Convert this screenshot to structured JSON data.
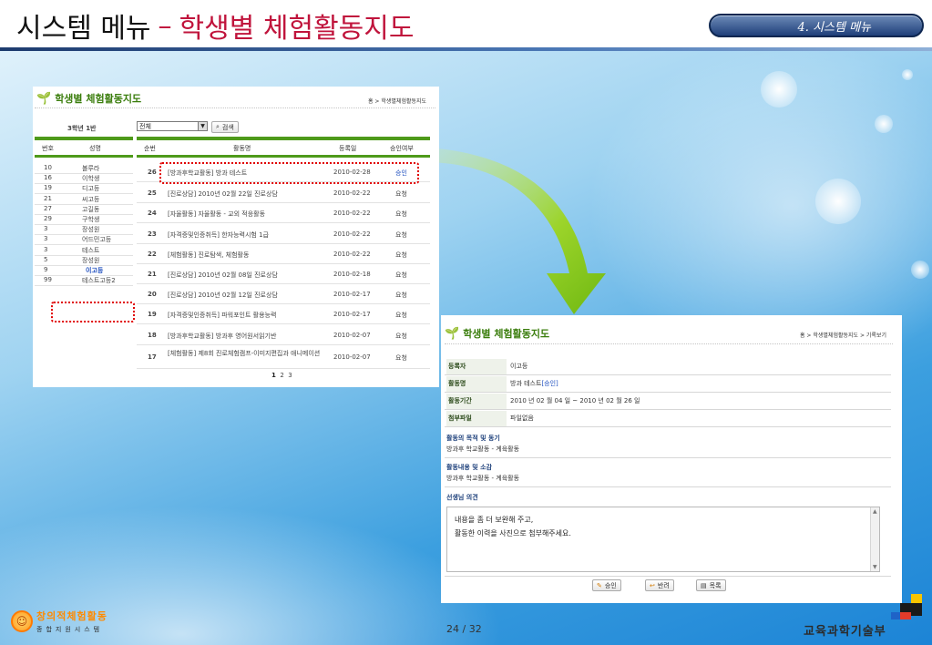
{
  "slide": {
    "title": "시스템 메뉴",
    "dash": "–",
    "subtitle": "학생별 체험활동지도",
    "badge": "4. 시스템 메뉴",
    "page": "24 / 32"
  },
  "logos": {
    "left_line1": "창의적체험활동",
    "left_line2": "종합지원시스템",
    "right": "교육과학기술부"
  },
  "list_panel": {
    "title": "학생별 체험활동지도",
    "breadcrumb": "홈 > 학생별체험활동지도",
    "class_label": "3학년 1반",
    "filter_value": "전체",
    "search_button": "검색",
    "student_headers": [
      "번호",
      "성명"
    ],
    "students": [
      {
        "no": "10",
        "name": "볼루라"
      },
      {
        "no": "16",
        "name": "이학생"
      },
      {
        "no": "19",
        "name": "디고등"
      },
      {
        "no": "21",
        "name": "씨고등"
      },
      {
        "no": "27",
        "name": "고길동"
      },
      {
        "no": "29",
        "name": "구학생"
      },
      {
        "no": "3",
        "name": "장성원"
      },
      {
        "no": "3",
        "name": "어드민고등"
      },
      {
        "no": "3",
        "name": "테스트"
      },
      {
        "no": "5",
        "name": "장성원"
      },
      {
        "no": "9",
        "name": "이고등"
      },
      {
        "no": "99",
        "name": "테스트고등2"
      }
    ],
    "activity_headers": [
      "순번",
      "활동명",
      "등록일",
      "승인여부"
    ],
    "activities": [
      {
        "no": "26",
        "name": "[방과후학교활동] 방과 테스트",
        "date": "2010-02-28",
        "status": "승인"
      },
      {
        "no": "25",
        "name": "[진로상담] 2010년 02월 22일 진로상담",
        "date": "2010-02-22",
        "status": "요청"
      },
      {
        "no": "24",
        "name": "[자율활동] 자율활동 - 교외 적응활동",
        "date": "2010-02-22",
        "status": "요청"
      },
      {
        "no": "23",
        "name": "[자격증및인증취득] 한자능력시험 1급",
        "date": "2010-02-22",
        "status": "요청"
      },
      {
        "no": "22",
        "name": "[체험활동] 진로탐색, 체험활동",
        "date": "2010-02-22",
        "status": "요청"
      },
      {
        "no": "21",
        "name": "[진로상담] 2010년 02월 08일 진로상담",
        "date": "2010-02-18",
        "status": "요청"
      },
      {
        "no": "20",
        "name": "[진로상담] 2010년 02월 12일 진로상담",
        "date": "2010-02-17",
        "status": "요청"
      },
      {
        "no": "19",
        "name": "[자격증및인증취득] 파워포인트 활용능력",
        "date": "2010-02-17",
        "status": "요청"
      },
      {
        "no": "18",
        "name": "[방과후학교활동] 방과후 영어원서읽기반",
        "date": "2010-02-07",
        "status": "요청"
      },
      {
        "no": "17",
        "name": "[체험활동] 제8회 진로체험캠프-이미지편집과 애니메이션",
        "date": "2010-02-07",
        "status": "요청"
      }
    ],
    "pagination": [
      "1",
      "2",
      "3"
    ]
  },
  "detail_panel": {
    "title": "학생별 체험활동지도",
    "breadcrumb": "홈 > 학생별체험활동지도 > 기록보기",
    "rows": [
      {
        "label": "등록자",
        "value": "이고등"
      },
      {
        "label": "활동명",
        "value": "방과 테스트",
        "badge": "[승인]"
      },
      {
        "label": "활동기간",
        "value": "2010 년 02 월 04 일 ~ 2010 년 02 월 26 일"
      },
      {
        "label": "첨부파일",
        "value": "파일없음"
      }
    ],
    "purpose_title": "활동의 목적 및 동기",
    "purpose_body": "방과후 학교활동 - 계육활동",
    "content_title": "활동내용 및 소감",
    "content_body": "방과후 학교활동 - 계육활동",
    "teacher_title": "선생님 의견",
    "comment_line1": "내용을 좀 더 보완해 주고,",
    "comment_line2": "활동한 이력을 사진으로 첨부해주세요.",
    "buttons": {
      "approve": "승인",
      "reject": "반려",
      "list": "목록"
    }
  },
  "colors": {
    "accent_red": "#c0143c",
    "panel_green": "#4e9a1a",
    "highlight": "#e00000"
  }
}
